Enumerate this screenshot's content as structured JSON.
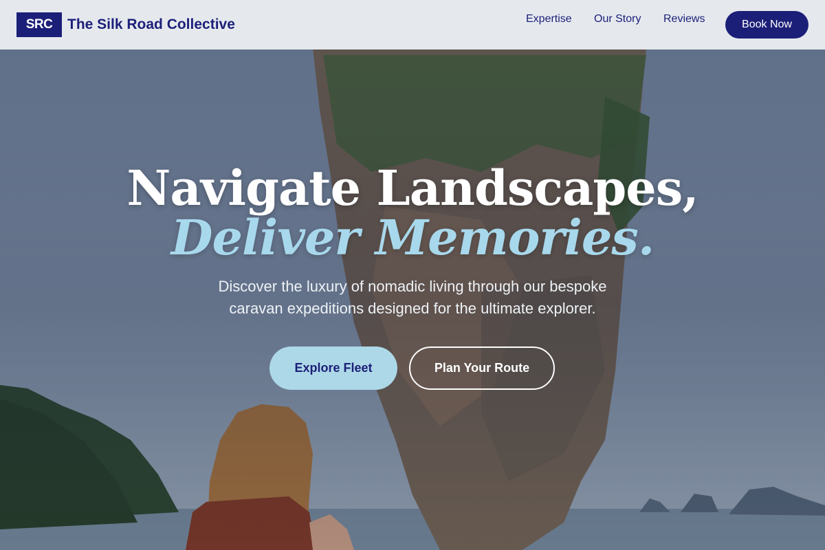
{
  "header": {
    "logo_text": "SRC",
    "brand_name": "The Silk Road Collective",
    "nav": [
      "Expertise",
      "Our Story",
      "Reviews"
    ],
    "cta_label": "Book Now"
  },
  "hero": {
    "headline_line1": "Navigate Landscapes,",
    "headline_line2": "Deliver Memories.",
    "subtitle": "Discover the luxury of nomadic living through our bespoke caravan expeditions designed for the ultimate explorer.",
    "primary_button": "Explore Fleet",
    "secondary_button": "Plan Your Route"
  },
  "colors": {
    "brand_navy": "#1c1f78",
    "accent_light_blue": "#add8e8",
    "headline_italic": "#a8d8ec"
  }
}
